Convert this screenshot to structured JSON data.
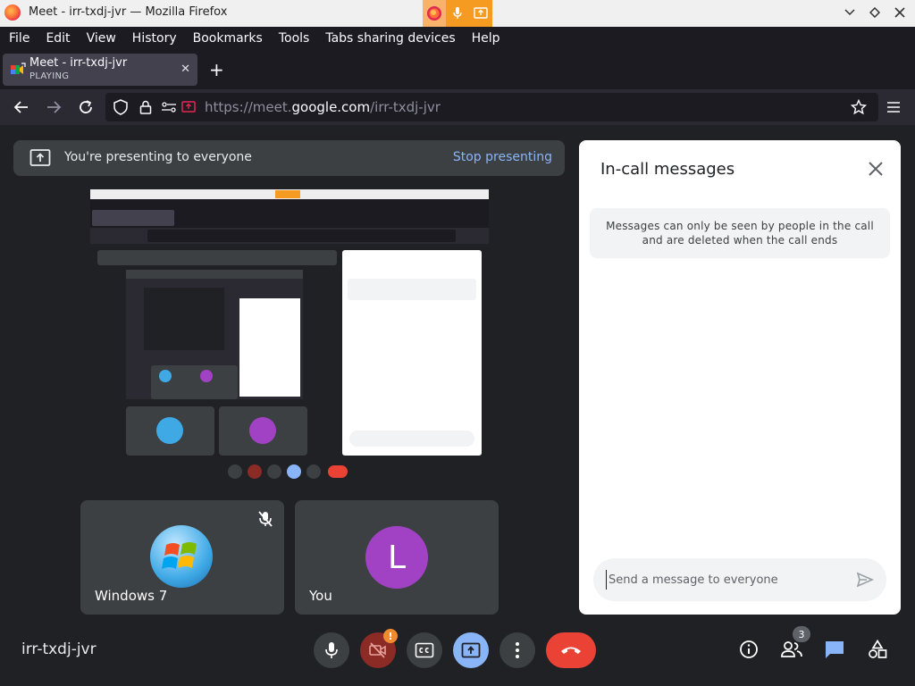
{
  "window": {
    "title": "Meet - irr-txdj-jvr — Mozilla Firefox"
  },
  "menubar": {
    "items": [
      "File",
      "Edit",
      "View",
      "History",
      "Bookmarks",
      "Tools",
      "Tabs sharing devices",
      "Help"
    ]
  },
  "tab": {
    "title": "Meet - irr-txdj-jvr",
    "status": "PLAYING",
    "close_glyph": "✕",
    "new_tab_glyph": "+"
  },
  "navbar": {
    "url_prefix": "https://meet.",
    "url_domain": "google.com",
    "url_path": "/irr-txdj-jvr"
  },
  "present_banner": {
    "text": "You're presenting to everyone",
    "stop_label": "Stop presenting"
  },
  "tiles": [
    {
      "name": "Windows 7",
      "muted": true
    },
    {
      "name": "You",
      "initial": "L",
      "color": "#a142c4"
    }
  ],
  "meeting_code": "irr-txdj-jvr",
  "controls": {
    "camera_warning": "!",
    "people_count": "3"
  },
  "chat": {
    "title": "In-call messages",
    "notice": "Messages can only be seen by people in the call and are deleted when the call ends",
    "placeholder": "Send a message to everyone"
  },
  "colors": {
    "accent": "#8ab4f8",
    "hangup": "#ea4335",
    "background": "#202124",
    "tile": "#3c4043"
  }
}
